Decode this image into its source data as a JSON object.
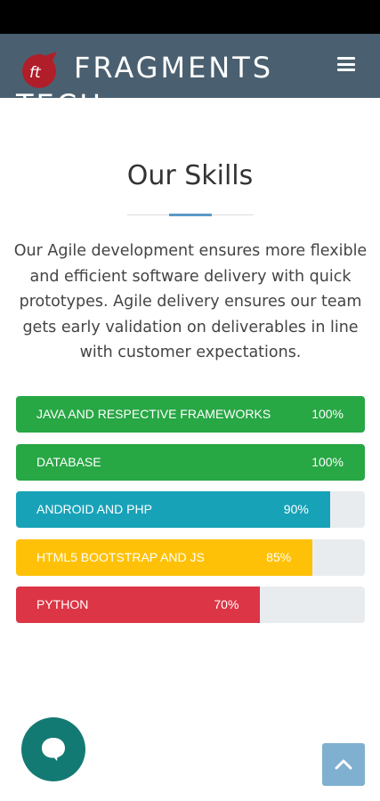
{
  "header": {
    "brand_line1": "FRAGMENTS",
    "brand_line2": "TECH",
    "logo_text": "ft",
    "nav_bg": "#4a6070"
  },
  "section": {
    "title": "Our Skills",
    "intro": "Our Agile development ensures more flexible and efficient software delivery with quick prototypes. Agile delivery ensures our team gets early validation on deliverables in line with customer expectations."
  },
  "skills": [
    {
      "label": "JAVA AND RESPECTIVE FRAMEWORKS",
      "percent_text": "100%",
      "level": 100,
      "color": "#28a745"
    },
    {
      "label": "DATABASE",
      "percent_text": "100%",
      "level": 100,
      "color": "#28a745"
    },
    {
      "label": "ANDROID AND PHP",
      "percent_text": "90%",
      "level": 90,
      "color": "#17a2b8"
    },
    {
      "label": "HTML5 BOOTSTRAP AND JS",
      "percent_text": "85%",
      "level": 85,
      "color": "#ffc107"
    },
    {
      "label": "PYTHON",
      "percent_text": "70%",
      "level": 70,
      "color": "#dc3545"
    }
  ],
  "widgets": {
    "chat_icon": "chat-bubble-icon",
    "back_to_top_icon": "chevron-up-icon"
  }
}
